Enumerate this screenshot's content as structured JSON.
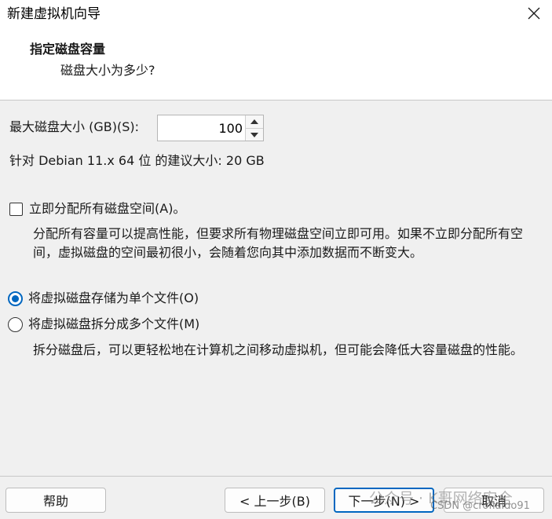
{
  "window": {
    "title": "新建虚拟机向导"
  },
  "header": {
    "title": "指定磁盘容量",
    "subtitle": "磁盘大小为多少?"
  },
  "disk_size": {
    "label": "最大磁盘大小 (GB)(S):",
    "value": "100"
  },
  "recommendation": "针对 Debian 11.x 64 位 的建议大小: 20 GB",
  "allocate_now": {
    "label": "立即分配所有磁盘空间(A)。",
    "checked": false,
    "description": "分配所有容量可以提高性能，但要求所有物理磁盘空间立即可用。如果不立即分配所有空间，虚拟磁盘的空间最初很小，会随着您向其中添加数据而不断变大。"
  },
  "storage": {
    "single_label": "将虚拟磁盘存储为单个文件(O)",
    "multi_label": "将虚拟磁盘拆分成多个文件(M)",
    "selected": "single",
    "multi_description": "拆分磁盘后，可以更轻松地在计算机之间移动虚拟机，但可能会降低大容量磁盘的性能。"
  },
  "buttons": {
    "help": "帮助",
    "back": "< 上一步(B)",
    "next": "下一步(N) >",
    "cancel": "取消"
  },
  "watermark": {
    "main": "公众号 · K哥网络安全",
    "csdn": "CSDN @croflaldo91"
  },
  "colors": {
    "accent": "#0067c0",
    "background": "#f0f0f0",
    "header_bg": "#ffffff"
  }
}
